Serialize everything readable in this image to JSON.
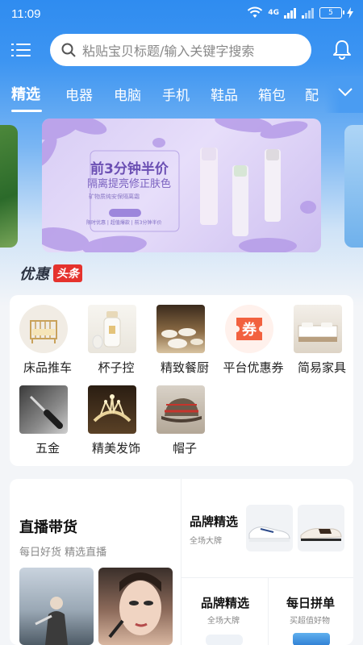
{
  "status_bar": {
    "time": "11:09",
    "network": "4G",
    "battery": "5"
  },
  "header": {
    "menu_icon": "menu-icon",
    "search_placeholder": "粘贴宝贝标题/输入关键字搜索",
    "bell_icon": "bell-icon"
  },
  "tabs": {
    "items": [
      "精选",
      "电器",
      "电脑",
      "手机",
      "鞋品",
      "箱包",
      "配"
    ],
    "active_index": 0,
    "more_icon": "chevron-down-icon"
  },
  "banner": {
    "title": "前3分钟半价",
    "subtitle": "隔离提亮修正肤色",
    "small_text": "矿物质纯安保隔离霜",
    "tags": "限时优惠 | 超值爆款 | 前3分钟半价"
  },
  "deals": {
    "logo_main": "优惠",
    "logo_badge": "头条"
  },
  "categories": [
    {
      "label": "床品推车"
    },
    {
      "label": "杯子控"
    },
    {
      "label": "精致餐厨"
    },
    {
      "label": "平台优惠券",
      "icon_text": "券"
    },
    {
      "label": "简易家具"
    },
    {
      "label": "五金"
    },
    {
      "label": "精美发饰"
    },
    {
      "label": "帽子"
    }
  ],
  "promo": {
    "live": {
      "title": "直播带货",
      "subtitle": "每日好货 精选直播"
    },
    "brand_top": {
      "title": "品牌精选",
      "subtitle": "全场大牌"
    },
    "brand_bottom": {
      "title": "品牌精选",
      "subtitle": "全场大牌"
    },
    "group_buy": {
      "title": "每日拼单",
      "subtitle": "买超值好物"
    }
  },
  "colors": {
    "accent_blue": "#2f8cf0",
    "badge_red": "#e5322d",
    "coupon_orange": "#f2613f"
  }
}
